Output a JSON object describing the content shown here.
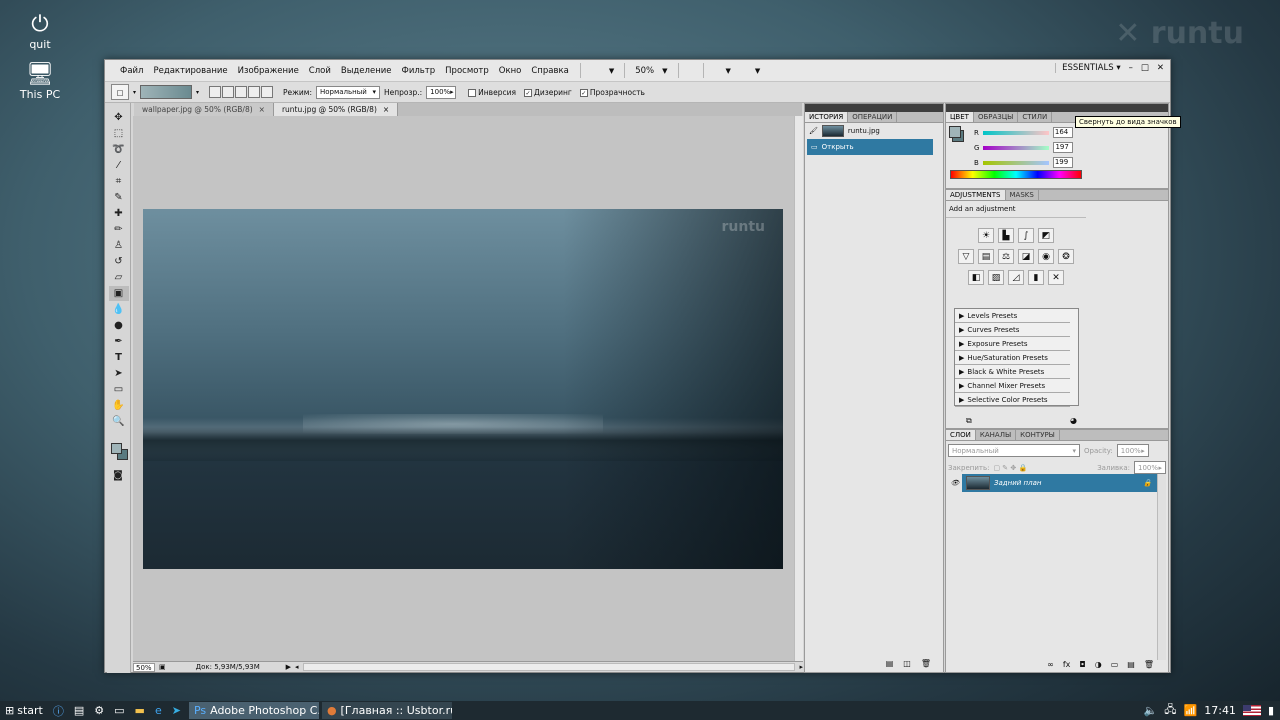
{
  "desktop": {
    "icons": [
      {
        "label": "quit",
        "icon": "power-icon"
      },
      {
        "label": "This PC",
        "icon": "computer-icon"
      }
    ]
  },
  "photoshop": {
    "menu": [
      "Файл",
      "Редактирование",
      "Изображение",
      "Слой",
      "Выделение",
      "Фильтр",
      "Просмотр",
      "Окно",
      "Справка"
    ],
    "zoom": "50%",
    "workspace": "ESSENTIALS",
    "options": {
      "mode_label": "Режим:",
      "mode_value": "Нормальный",
      "opacity_label": "Непрозр.:",
      "opacity_value": "100%",
      "inverse_label": "Инверсия",
      "dither_label": "Дизеринг",
      "transparency_label": "Прозрачность"
    },
    "doc_tabs": [
      {
        "label": "wallpaper.jpg @ 50% (RGB/8)",
        "active": false
      },
      {
        "label": "runtu.jpg @ 50% (RGB/8)",
        "active": true
      }
    ],
    "canvas_watermark": "runtu",
    "status": {
      "zoom": "50%",
      "doc": "Док: 5,93M/5,93M"
    },
    "history": {
      "tabs": [
        "ИСТОРИЯ",
        "ОПЕРАЦИИ"
      ],
      "snapshot": "runtu.jpg",
      "items": [
        "Открыть"
      ]
    },
    "color": {
      "tabs": [
        "ЦВЕТ",
        "ОБРАЗЦЫ",
        "СТИЛИ"
      ],
      "r": "164",
      "g": "197",
      "b": "199",
      "tooltip": "Свернуть до вида значков"
    },
    "adjustments": {
      "tabs": [
        "ADJUSTMENTS",
        "MASKS"
      ],
      "hint": "Add an adjustment",
      "presets": [
        "Levels Presets",
        "Curves Presets",
        "Exposure Presets",
        "Hue/Saturation Presets",
        "Black & White Presets",
        "Channel Mixer Presets",
        "Selective Color Presets"
      ]
    },
    "layers": {
      "tabs": [
        "СЛОИ",
        "КАНАЛЫ",
        "КОНТУРЫ"
      ],
      "blend": "Нормальный",
      "opacity_label": "Opacity:",
      "opacity": "100%",
      "lock_label": "Закрепить:",
      "fill_label": "Заливка:",
      "fill": "100%",
      "layer_name": "Задний план"
    }
  },
  "taskbar": {
    "start": "start",
    "tasks": [
      {
        "label": "Adobe Photoshop C...",
        "active": true
      },
      {
        "label": "[Главная :: Usbtor.ru...",
        "active": false
      }
    ],
    "clock": "17:41"
  },
  "colors": {
    "selection": "#2f79a2",
    "fg_swatch": "#9fb4b8",
    "bg_swatch": "#5a7a80"
  }
}
